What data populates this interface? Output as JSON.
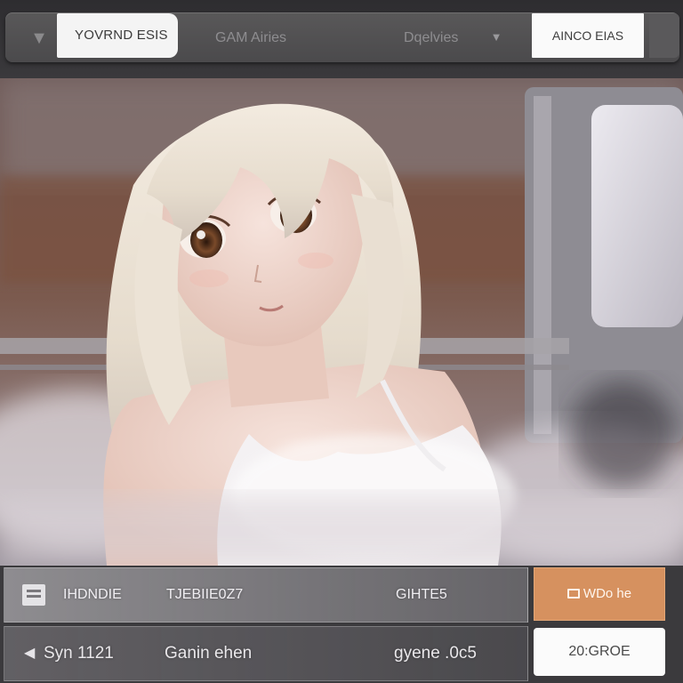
{
  "topbar": {
    "tab_active_label": "YOVRND ESIS",
    "tab_games_label": "GAM Airies",
    "tab_deliveries_label": "Dqelvies",
    "right_button_label": "AINCO EIAS"
  },
  "rows": [
    {
      "col1": "IHDNDIE",
      "col2": "TJEBIIE0Z7",
      "col3": "GIHTE5",
      "button_label": "WDo he"
    },
    {
      "col1": "Syn 1121",
      "col2": "Ganin ehen",
      "col3": "gyene .0c5",
      "button_label": "20:GROE"
    }
  ],
  "colors": {
    "accent_orange": "#d6915f",
    "topbar_bg": "#4b4a4c",
    "panel_bg": "#3b3a3d"
  },
  "icons": [
    "menu-icon",
    "arrow-down-icon",
    "list-icon",
    "back-arrow-icon",
    "card-icon"
  ]
}
